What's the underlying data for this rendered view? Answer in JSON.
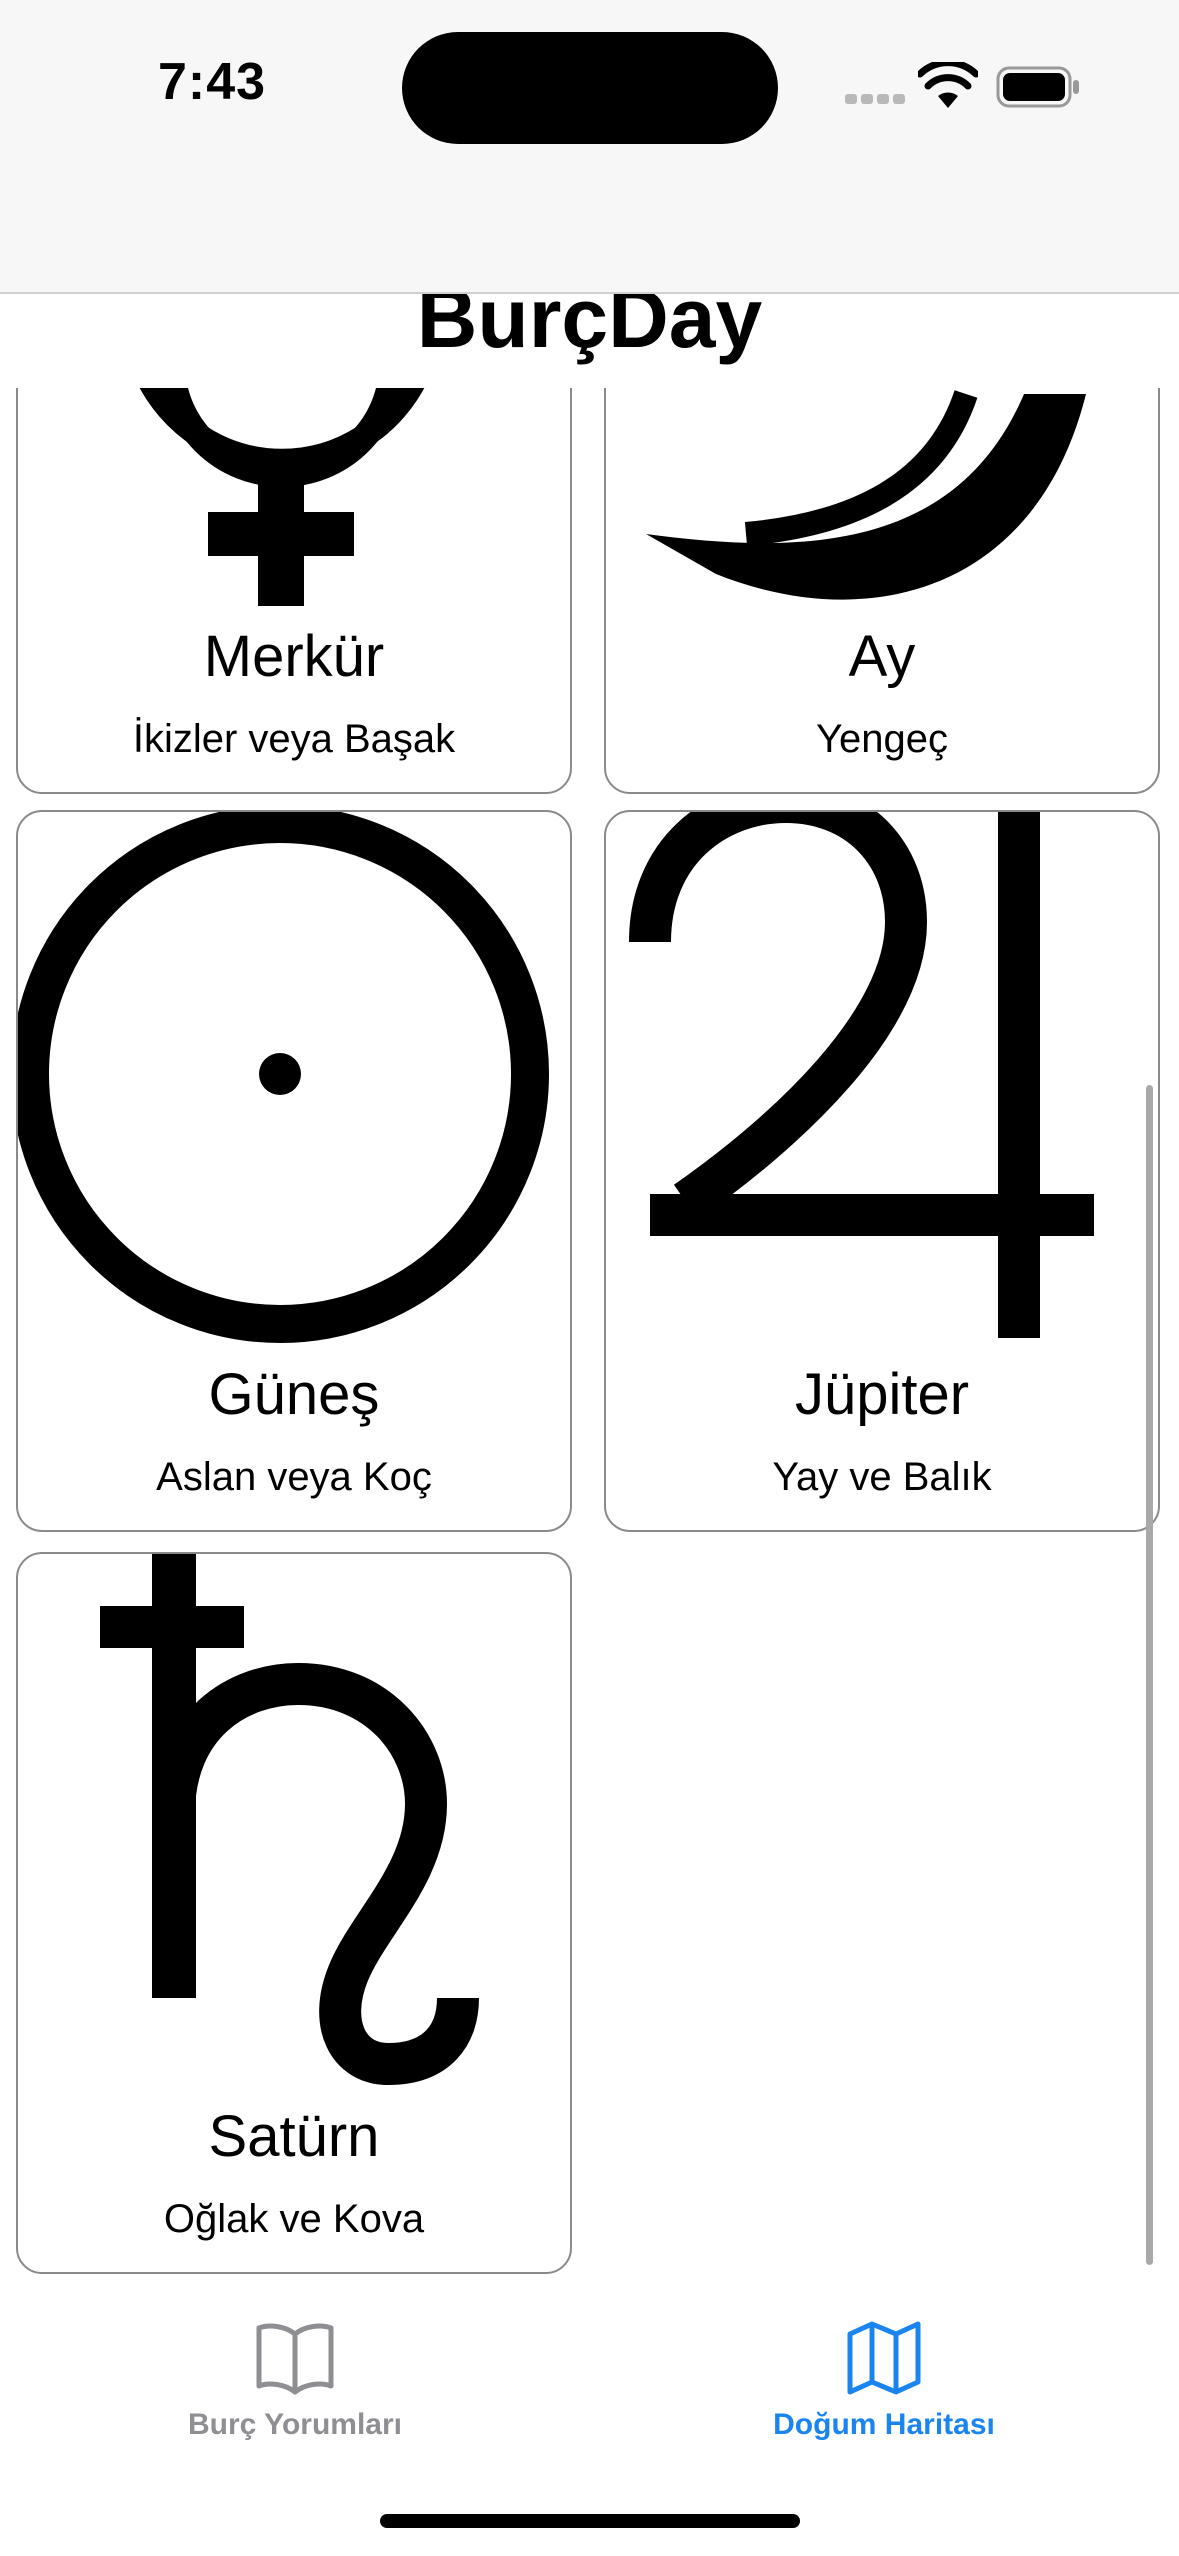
{
  "status_bar": {
    "time": "7:43"
  },
  "header": {
    "title": "BurçDay"
  },
  "planets": [
    {
      "name": "Merkür",
      "signs": "İkizler veya Başak",
      "icon": "mercury-icon"
    },
    {
      "name": "Ay",
      "signs": "Yengeç",
      "icon": "moon-icon"
    },
    {
      "name": "Güneş",
      "signs": "Aslan veya Koç",
      "icon": "sun-icon"
    },
    {
      "name": "Jüpiter",
      "signs": "Yay ve Balık",
      "icon": "jupiter-icon"
    },
    {
      "name": "Satürn",
      "signs": "Oğlak ve Kova",
      "icon": "saturn-icon"
    }
  ],
  "tabs": [
    {
      "label": "Burç Yorumları",
      "icon": "book-icon",
      "selected": false
    },
    {
      "label": "Doğum Haritası",
      "icon": "map-icon",
      "selected": true
    }
  ],
  "colors": {
    "accent": "#1a84f0",
    "inactive": "#8e8e93",
    "card_border": "#8a8a8a"
  }
}
